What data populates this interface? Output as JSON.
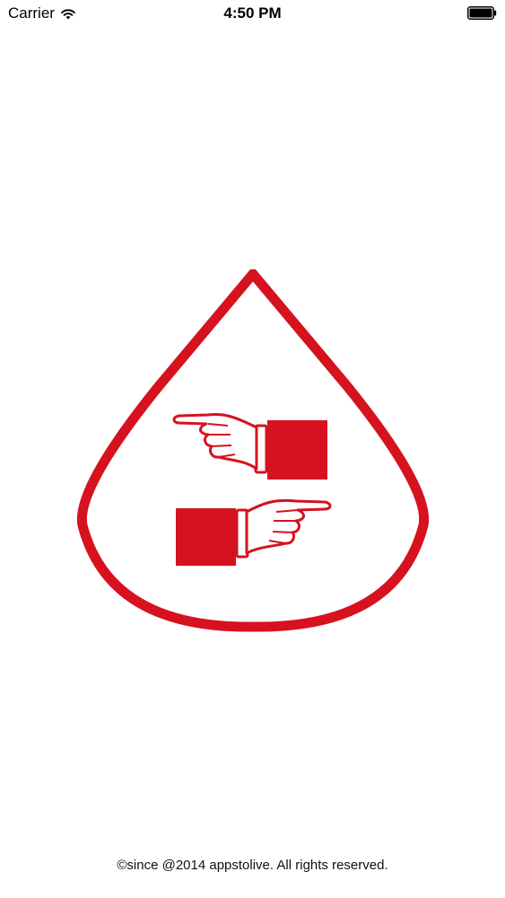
{
  "status_bar": {
    "carrier": "Carrier",
    "time": "4:50 PM",
    "icons": [
      "wifi-icon",
      "battery-icon"
    ]
  },
  "splash": {
    "logo_icon": "pointing-hands-drop-logo",
    "brand_color": "#d6121f",
    "footer": "©since @2014 appstolive. All rights reserved."
  }
}
